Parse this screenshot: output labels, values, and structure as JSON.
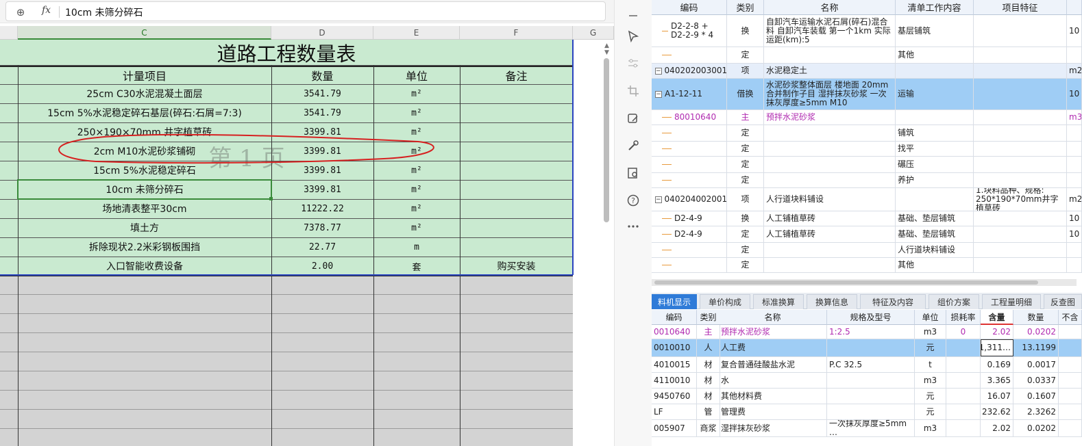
{
  "formula_bar": {
    "fx_label": "fx",
    "content": "10cm 未筛分碎石"
  },
  "columns": [
    "C",
    "D",
    "E",
    "F",
    "G"
  ],
  "sheet": {
    "title": "道路工程数量表",
    "headers": [
      "计量项目",
      "数量",
      "单位",
      "备注"
    ],
    "rows": [
      {
        "item": "25cm C30水泥混凝土面层",
        "qty": "3541.79",
        "unit": "m²",
        "note": ""
      },
      {
        "item": "15cm 5%水泥稳定碎石基层(碎石:石屑=7:3)",
        "qty": "3541.79",
        "unit": "m²",
        "note": ""
      },
      {
        "item": "250×190×70mm 井字植草砖",
        "qty": "3399.81",
        "unit": "m²",
        "note": ""
      },
      {
        "item": "2cm M10水泥砂浆铺砌",
        "qty": "3399.81",
        "unit": "m²",
        "note": ""
      },
      {
        "item": "15cm 5%水泥稳定碎石",
        "qty": "3399.81",
        "unit": "m²",
        "note": ""
      },
      {
        "item": "10cm 未筛分碎石",
        "qty": "3399.81",
        "unit": "m²",
        "note": ""
      },
      {
        "item": "场地清表整平30cm",
        "qty": "11222.22",
        "unit": "m²",
        "note": ""
      },
      {
        "item": "填土方",
        "qty": "7378.77",
        "unit": "m²",
        "note": ""
      },
      {
        "item": "拆除现状2.2米彩钢板围挡",
        "qty": "22.77",
        "unit": "m",
        "note": ""
      },
      {
        "item": "入口智能收费设备",
        "qty": "2.00",
        "unit": "套",
        "note": "购买安装"
      }
    ],
    "watermark": "第 1 页"
  },
  "upper_table": {
    "headers": [
      "编码",
      "类别",
      "名称",
      "清单工作内容",
      "项目特征"
    ],
    "rows": [
      {
        "code": "D2-2-8 + D2-2-9 * 4",
        "cat": "换",
        "name": "自卸汽车运输水泥石屑(碎石)混合料 自卸汽车装载 第一个1km 实际运距(km):5",
        "work": "基层铺筑",
        "feature": "",
        "extra": "10"
      },
      {
        "code": "",
        "cat": "定",
        "name": "",
        "work": "其他",
        "feature": "",
        "extra": ""
      },
      {
        "code": "040202003001",
        "cat": "项",
        "name": "水泥稳定土",
        "work": "",
        "feature": "",
        "extra": "m2"
      },
      {
        "code": "A1-12-11",
        "cat": "借换",
        "name": "水泥砂浆整体面层 楼地面 20mm 合并制作子目 湿拌抹灰砂浆 一次抹灰厚度≥5mm M10",
        "work": "运输",
        "feature": "",
        "extra": "10"
      },
      {
        "code": "80010640",
        "cat": "主",
        "name": "预拌水泥砂浆",
        "work": "",
        "feature": "",
        "extra": "m3"
      },
      {
        "code": "",
        "cat": "定",
        "name": "",
        "work": "铺筑",
        "feature": "",
        "extra": ""
      },
      {
        "code": "",
        "cat": "定",
        "name": "",
        "work": "找平",
        "feature": "",
        "extra": ""
      },
      {
        "code": "",
        "cat": "定",
        "name": "",
        "work": "碾压",
        "feature": "",
        "extra": ""
      },
      {
        "code": "",
        "cat": "定",
        "name": "",
        "work": "养护",
        "feature": "",
        "extra": ""
      },
      {
        "code": "040204002001",
        "cat": "项",
        "name": "人行道块料铺设",
        "work": "",
        "feature": "1.块料品种、规格: 250*190*70mm井字植草砖",
        "extra": "m2"
      },
      {
        "code": "D2-4-9",
        "cat": "换",
        "name": "人工铺植草砖",
        "work": "基础、垫层铺筑",
        "feature": "",
        "extra": "10"
      },
      {
        "code": "D2-4-9",
        "cat": "定",
        "name": "人工铺植草砖",
        "work": "基础、垫层铺筑",
        "feature": "",
        "extra": "10"
      },
      {
        "code": "",
        "cat": "定",
        "name": "",
        "work": "人行道块料铺设",
        "feature": "",
        "extra": ""
      },
      {
        "code": "",
        "cat": "定",
        "name": "",
        "work": "其他",
        "feature": "",
        "extra": ""
      }
    ]
  },
  "tabs": [
    "料机显示",
    "单价构成",
    "标准换算",
    "换算信息",
    "特征及内容",
    "组价方案",
    "工程量明细",
    "反查图"
  ],
  "lower_table": {
    "headers": [
      "编码",
      "类别",
      "名称",
      "规格及型号",
      "单位",
      "损耗率",
      "含量",
      "数量",
      "不含"
    ],
    "rows": [
      {
        "code": "0010640",
        "cat": "主",
        "name": "预拌水泥砂浆",
        "spec": "1:2.5",
        "unit": "m3",
        "loss": "0",
        "content": "2.02",
        "qty": "0.0202"
      },
      {
        "code": "0010010",
        "cat": "人",
        "name": "人工费",
        "spec": "",
        "unit": "元",
        "loss": "",
        "content": "1,311…",
        "qty": "13.1199"
      },
      {
        "code": "4010015",
        "cat": "材",
        "name": "复合普通硅酸盐水泥",
        "spec": "P.C 32.5",
        "unit": "t",
        "loss": "",
        "content": "0.169",
        "qty": "0.0017"
      },
      {
        "code": "4110010",
        "cat": "材",
        "name": "水",
        "spec": "",
        "unit": "m3",
        "loss": "",
        "content": "3.365",
        "qty": "0.0337"
      },
      {
        "code": "9450760",
        "cat": "材",
        "name": "其他材料费",
        "spec": "",
        "unit": "元",
        "loss": "",
        "content": "16.07",
        "qty": "0.1607"
      },
      {
        "code": "LF",
        "cat": "管",
        "name": "管理费",
        "spec": "",
        "unit": "元",
        "loss": "",
        "content": "232.62",
        "qty": "2.3262"
      },
      {
        "code": "005907",
        "cat": "商浆",
        "name": "湿拌抹灰砂浆",
        "spec": "一次抹灰厚度≥5mm …",
        "unit": "m3",
        "loss": "",
        "content": "2.02",
        "qty": "0.0202"
      }
    ]
  }
}
